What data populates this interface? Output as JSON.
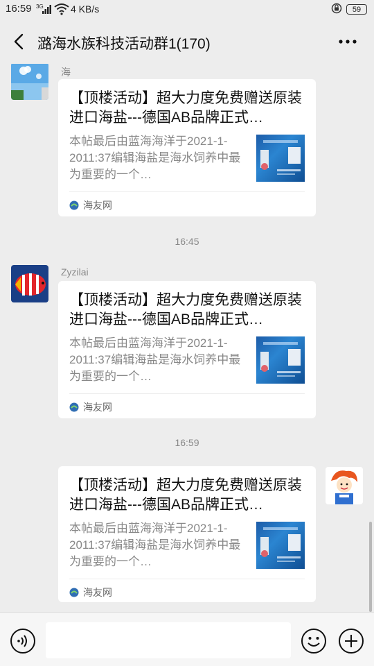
{
  "status_bar": {
    "time": "16:59",
    "network": "3G",
    "speed": "4 KB/s",
    "battery": "59"
  },
  "header": {
    "title": "潞海水族科技活动群1(170)"
  },
  "messages": [
    {
      "sender": "海",
      "title": "【顶楼活动】超大力度免费赠送原装进口海盐---德国AB品牌正式…",
      "desc": "本帖最后由蓝海海洋于2021-1-2011:37编辑海盐是海水饲养中最为重要的一个…",
      "source": "海友网"
    },
    {
      "sender": "Zyzilai",
      "title": "【顶楼活动】超大力度免费赠送原装进口海盐---德国AB品牌正式…",
      "desc": "本帖最后由蓝海海洋于2021-1-2011:37编辑海盐是海水饲养中最为重要的一个…",
      "source": "海友网"
    },
    {
      "sender": "",
      "title": "【顶楼活动】超大力度免费赠送原装进口海盐---德国AB品牌正式…",
      "desc": "本帖最后由蓝海海洋于2021-1-2011:37编辑海盐是海水饲养中最为重要的一个…",
      "source": "海友网"
    }
  ],
  "timestamps": [
    "16:45",
    "16:59"
  ],
  "input": {
    "placeholder": ""
  },
  "icons": {
    "back": "back-arrow-icon",
    "more": "more-dots-icon",
    "voice": "voice-icon",
    "emoji": "emoji-icon",
    "plus": "plus-icon",
    "source": "haiyou-logo-icon"
  },
  "colors": {
    "background": "#ededed",
    "card": "#ffffff",
    "muted": "#888888",
    "bottom_bar": "#f6f6f6"
  }
}
